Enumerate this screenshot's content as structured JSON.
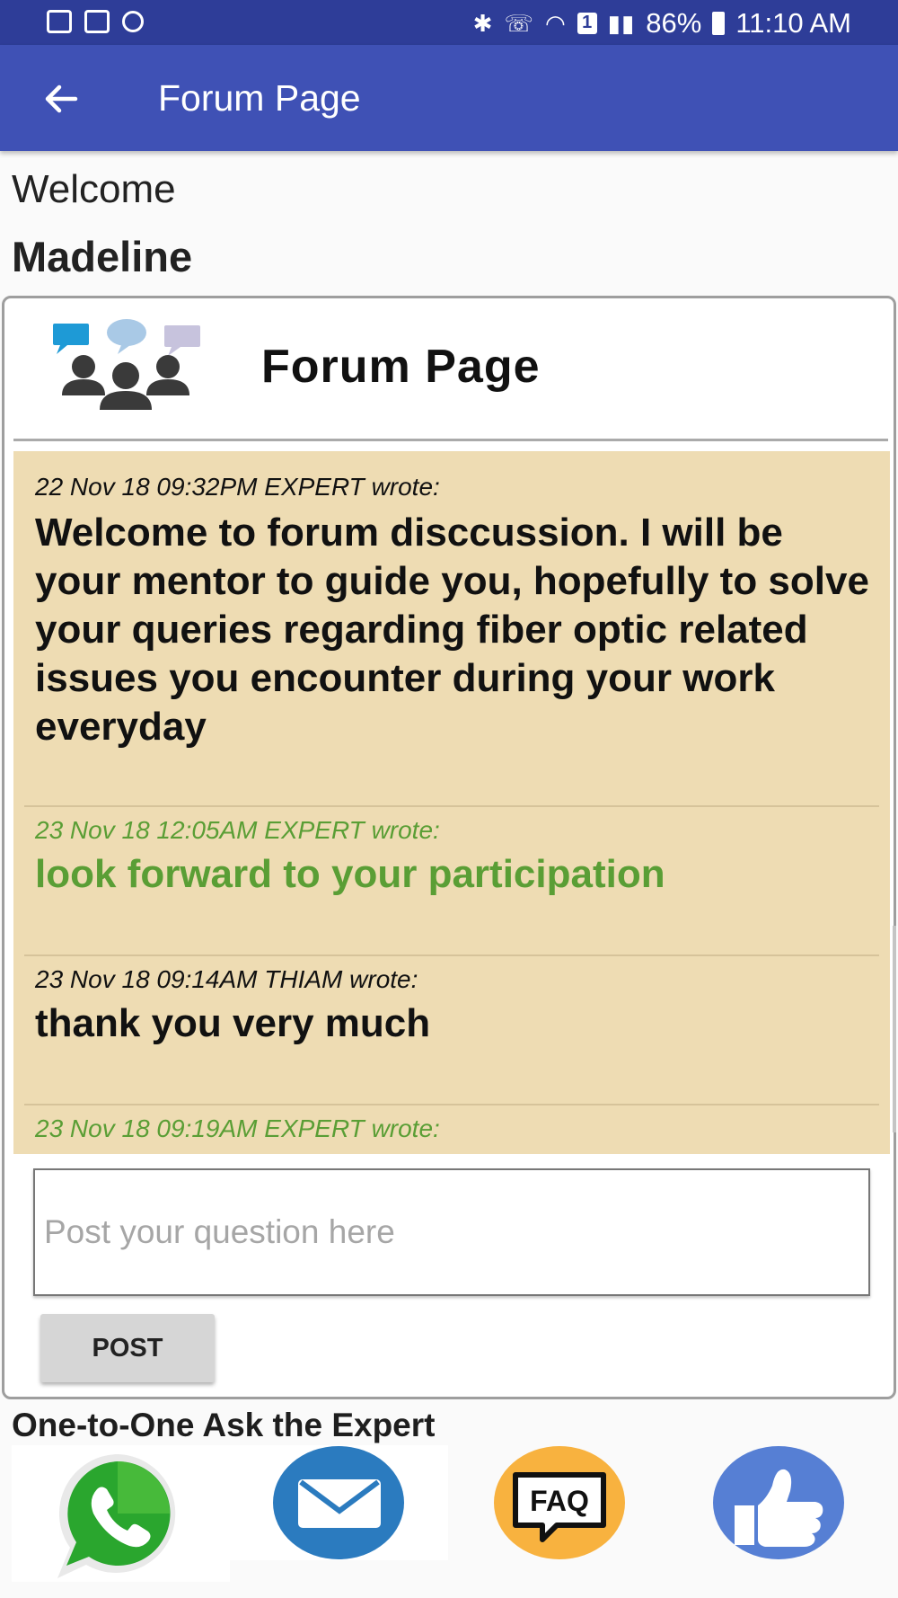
{
  "status_bar": {
    "battery": "86%",
    "time": "11:10 AM",
    "sim_slot": "1"
  },
  "app_bar": {
    "title": "Forum Page"
  },
  "greeting": {
    "welcome": "Welcome",
    "user_name": "Madeline"
  },
  "forum_card": {
    "title": "Forum Page",
    "messages": [
      {
        "meta": "22 Nov 18 09:32PM EXPERT wrote:",
        "body": "Welcome to forum disccussion. I will be your mentor to guide you, hopefully to solve your queries regarding fiber optic related issues you encounter during your work everyday",
        "color": "#111111"
      },
      {
        "meta": "23 Nov 18 12:05AM EXPERT wrote:",
        "body": "look forward to your participation",
        "color": "#5a9e35"
      },
      {
        "meta": "23 Nov 18 09:14AM THIAM wrote:",
        "body": "thank you very much",
        "color": "#111111"
      },
      {
        "meta": "23 Nov 18 09:19AM EXPERT wrote:",
        "body": "",
        "color": "#5a9e35"
      }
    ],
    "input": {
      "placeholder": "Post your question here",
      "value": ""
    },
    "post_button": "POST"
  },
  "expert_section": {
    "title": "One-to-One Ask the Expert",
    "icons": [
      "whatsapp-icon",
      "mail-icon",
      "faq-icon",
      "thumbs-up-icon"
    ],
    "faq_label": "FAQ"
  },
  "colors": {
    "status_bar": "#2e3d98",
    "app_bar": "#3f51b5",
    "messages_bg": "#eedcb3",
    "expert_green": "#5a9e35"
  }
}
